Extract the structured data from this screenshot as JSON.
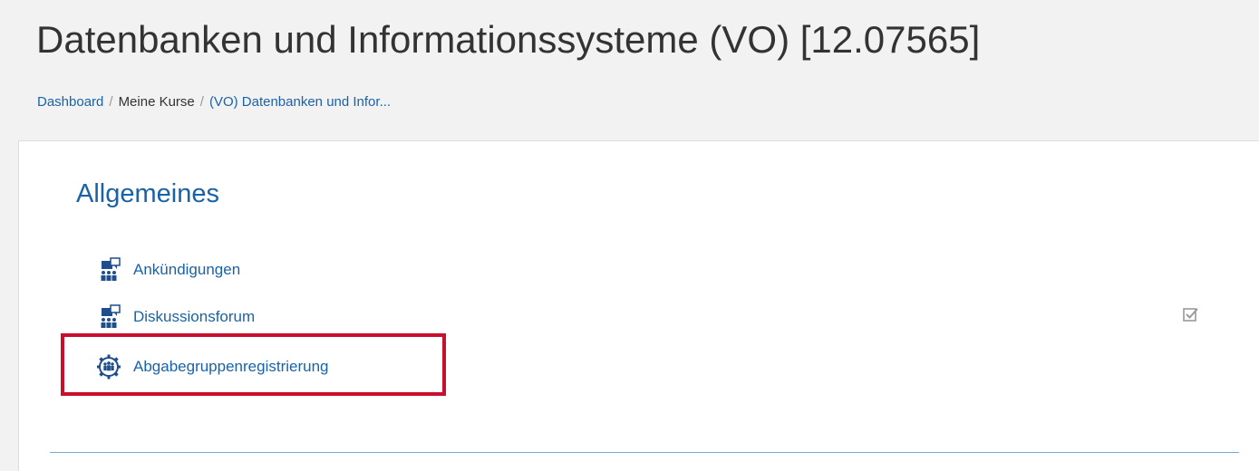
{
  "page": {
    "title": "Datenbanken und Informationssysteme (VO) [12.07565]"
  },
  "breadcrumb": {
    "items": [
      {
        "label": "Dashboard"
      },
      {
        "label": "Meine Kurse"
      },
      {
        "label": "(VO) Datenbanken und Infor..."
      }
    ],
    "separator": "/"
  },
  "section": {
    "title": "Allgemeines",
    "activities": [
      {
        "label": "Ankündigungen",
        "icon": "forum-icon"
      },
      {
        "label": "Diskussionsforum",
        "icon": "forum-icon",
        "completion": "checked"
      },
      {
        "label": "Abgabegruppenregistrierung",
        "icon": "group-registration-icon"
      }
    ]
  },
  "colors": {
    "link": "#1a62a8",
    "highlight": "#c8102e",
    "icon": "#1f4e8c"
  }
}
